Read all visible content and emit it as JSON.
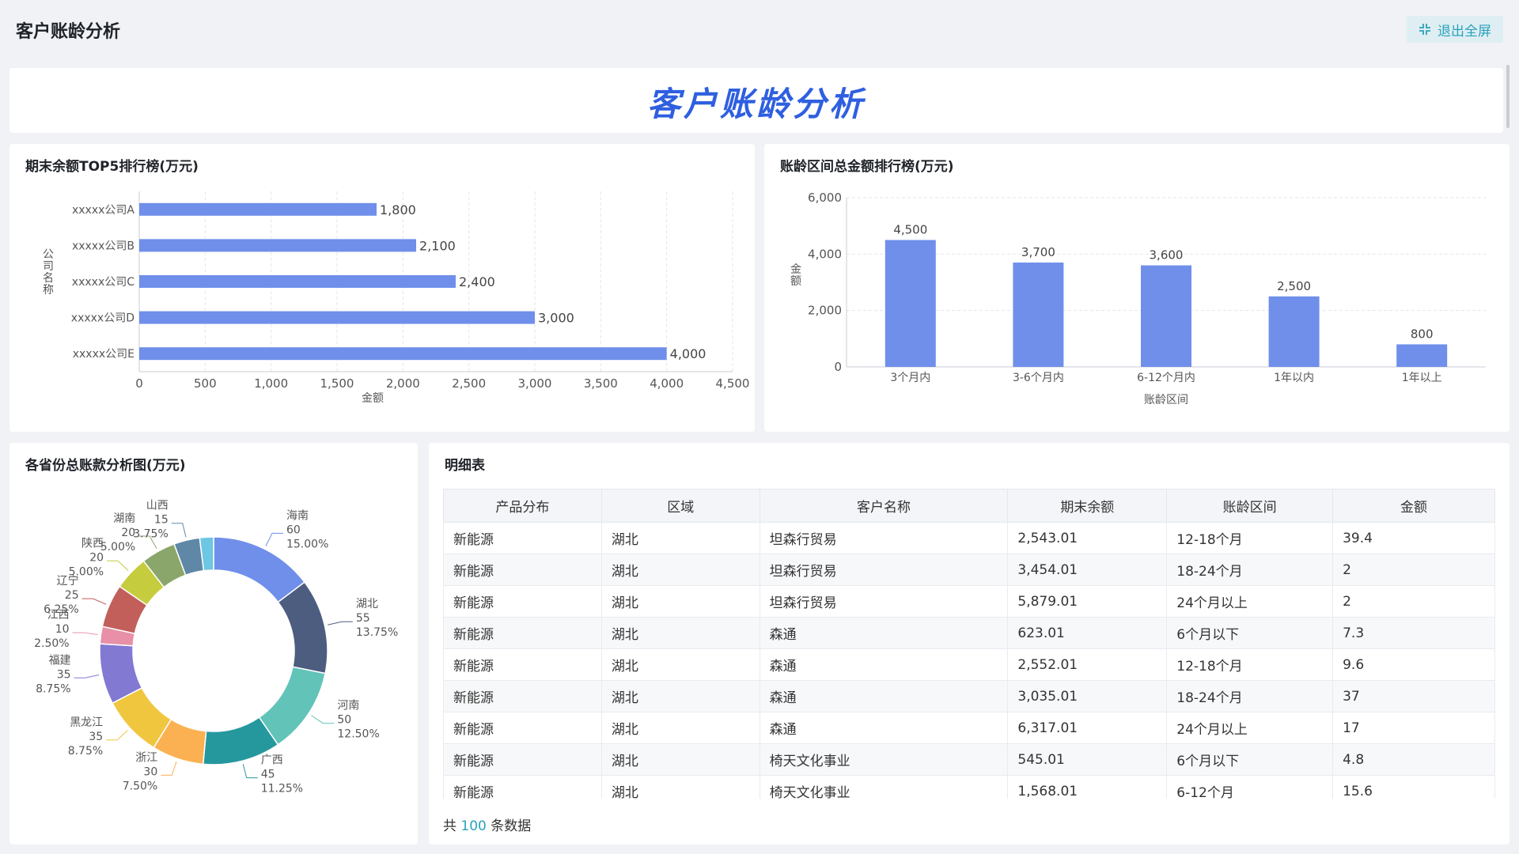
{
  "header": {
    "page_title": "客户账龄分析",
    "exit_fullscreen_label": "退出全屏",
    "exit_icon": "compress-icon"
  },
  "banner": {
    "title": "客户账龄分析"
  },
  "colors": {
    "accent": "#2aa2bc",
    "bar": "#6f8fea",
    "banner_title": "#2f5fe0"
  },
  "chart_top5": {
    "title": "期末余额TOP5排行榜(万元)",
    "chart_data": {
      "type": "bar",
      "orientation": "horizontal",
      "categories": [
        "xxxxx公司A",
        "xxxxx公司B",
        "xxxxx公司C",
        "xxxxx公司D",
        "xxxxx公司E"
      ],
      "values": [
        1800,
        2100,
        2400,
        3000,
        4000
      ],
      "value_labels": [
        "1,800",
        "2,100",
        "2,400",
        "3,000",
        "4,000"
      ],
      "xlabel": "金额",
      "ylabel": "公司名称",
      "xlim": [
        0,
        4500
      ],
      "xticks": [
        "0",
        "500",
        "1,000",
        "1,500",
        "2,000",
        "2,500",
        "3,000",
        "3,500",
        "4,000",
        "4,500"
      ],
      "grid": true
    }
  },
  "chart_aging": {
    "title": "账龄区间总金额排行榜(万元)",
    "chart_data": {
      "type": "bar",
      "categories": [
        "3个月内",
        "3-6个月内",
        "6-12个月内",
        "1年以内",
        "1年以上"
      ],
      "values": [
        4500,
        3700,
        3600,
        2500,
        800
      ],
      "value_labels": [
        "4,500",
        "3,700",
        "3,600",
        "2,500",
        "800"
      ],
      "xlabel": "账龄区间",
      "ylabel": "金额",
      "ylim": [
        0,
        6000
      ],
      "yticks": [
        "0",
        "2,000",
        "4,000",
        "6,000"
      ],
      "grid": true
    }
  },
  "chart_province": {
    "title": "各省份总账款分析图(万元)",
    "chart_data": {
      "type": "pie",
      "donut": true,
      "slices": [
        {
          "name": "海南",
          "value": 60,
          "percent": "15.00%",
          "color": "#6f8fea"
        },
        {
          "name": "湖北",
          "value": 55,
          "percent": "13.75%",
          "color": "#4c5d80"
        },
        {
          "name": "河南",
          "value": 50,
          "percent": "12.50%",
          "color": "#62c3b9"
        },
        {
          "name": "广西",
          "value": 45,
          "percent": "11.25%",
          "color": "#25989e"
        },
        {
          "name": "浙江",
          "value": 30,
          "percent": "7.50%",
          "color": "#fbb152"
        },
        {
          "name": "黑龙江",
          "value": 35,
          "percent": "8.75%",
          "color": "#f0c63f"
        },
        {
          "name": "福建",
          "value": 35,
          "percent": "8.75%",
          "color": "#8279d3"
        },
        {
          "name": "江西",
          "value": 10,
          "percent": "2.50%",
          "color": "#e790a8"
        },
        {
          "name": "辽宁",
          "value": 25,
          "percent": "6.25%",
          "color": "#c25f5b"
        },
        {
          "name": "陕西",
          "value": 20,
          "percent": "5.00%",
          "color": "#c5cc3e"
        },
        {
          "name": "湖南",
          "value": 20,
          "percent": "5.00%",
          "color": "#8aa66a"
        },
        {
          "name": "山西",
          "value": 15,
          "percent": "3.75%",
          "color": "#5f87a6"
        },
        {
          "name": "",
          "value": 8,
          "percent": "",
          "color": "#6dc6e3"
        }
      ]
    }
  },
  "detail_table": {
    "title": "明细表",
    "columns": [
      "产品分布",
      "区域",
      "客户名称",
      "期末余额",
      "账龄区间",
      "金额"
    ],
    "rows": [
      [
        "新能源",
        "湖北",
        "坦森行贸易",
        "2,543.01",
        "12-18个月",
        "39.4"
      ],
      [
        "新能源",
        "湖北",
        "坦森行贸易",
        "3,454.01",
        "18-24个月",
        "2"
      ],
      [
        "新能源",
        "湖北",
        "坦森行贸易",
        "5,879.01",
        "24个月以上",
        "2"
      ],
      [
        "新能源",
        "湖北",
        "森通",
        "623.01",
        "6个月以下",
        "7.3"
      ],
      [
        "新能源",
        "湖北",
        "森通",
        "2,552.01",
        "12-18个月",
        "9.6"
      ],
      [
        "新能源",
        "湖北",
        "森通",
        "3,035.01",
        "18-24个月",
        "37"
      ],
      [
        "新能源",
        "湖北",
        "森通",
        "6,317.01",
        "24个月以上",
        "17"
      ],
      [
        "新能源",
        "湖北",
        "椅天文化事业",
        "545.01",
        "6个月以下",
        "4.8"
      ],
      [
        "新能源",
        "湖北",
        "椅天文化事业",
        "1,568.01",
        "6-12个月",
        "15.6"
      ]
    ],
    "count_prefix": "共",
    "count_value": "100",
    "count_suffix": "条数据"
  }
}
